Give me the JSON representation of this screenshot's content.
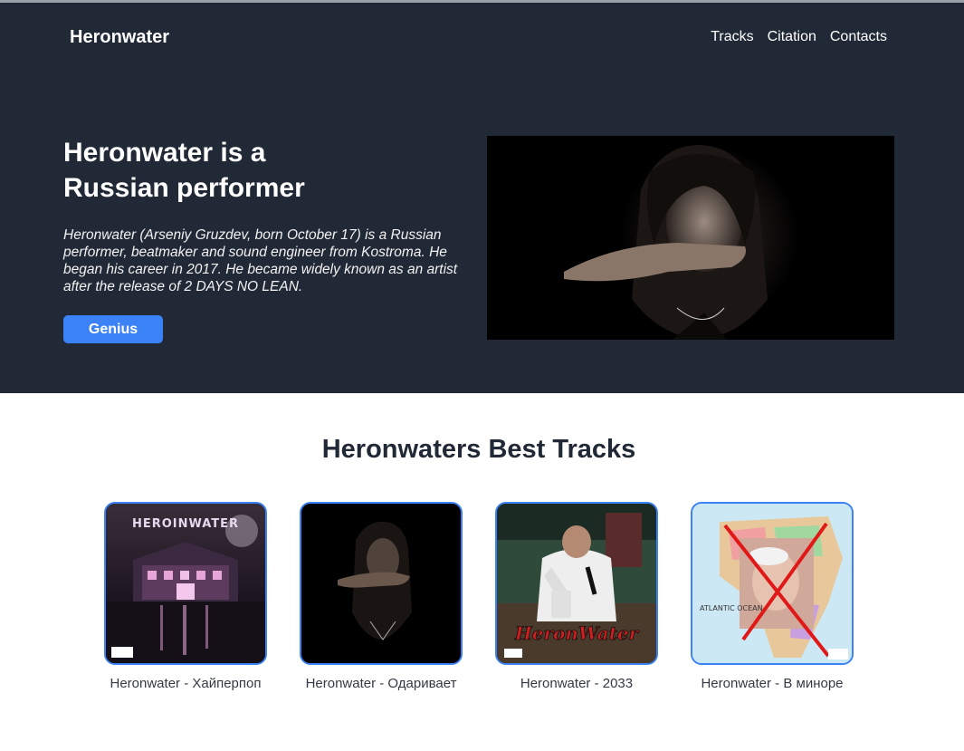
{
  "header": {
    "brand": "Heronwater",
    "nav": [
      "Tracks",
      "Citation",
      "Contacts"
    ]
  },
  "hero": {
    "title": "Heronwater is a Russian performer",
    "description": "Heronwater (Arseniy Gruzdev, born October 17) is a Russian performer, beatmaker and sound engineer from Kostroma. He began his career in 2017. He became widely known as an artist after the release of 2 DAYS NO LEAN.",
    "button_label": "Genius"
  },
  "tracks_section": {
    "title": "Heronwaters Best Tracks",
    "tracks": [
      {
        "label": "Heronwater - Хайперпоп",
        "cover_text": "HEROINWATER"
      },
      {
        "label": "Heronwater - Одаривает"
      },
      {
        "label": "Heronwater - 2033",
        "cover_text": "HeronWater"
      },
      {
        "label": "Heronwater - В миноре",
        "cover_text": "ATLANTIC OCEAN"
      }
    ]
  },
  "colors": {
    "hero_bg": "#212836",
    "accent": "#3b82f6",
    "heading_dark": "#212836"
  }
}
